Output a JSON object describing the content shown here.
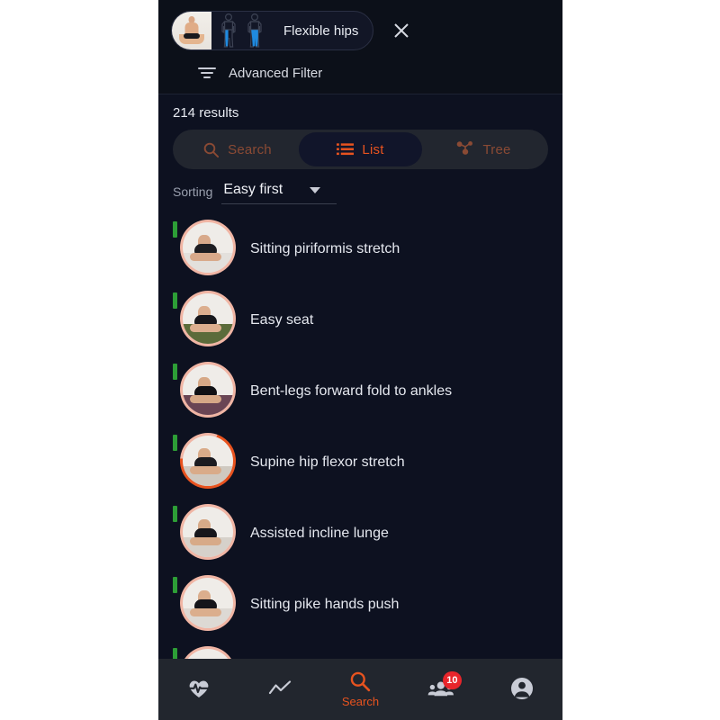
{
  "theme": {
    "page_bg": "#ffffff",
    "app_bg": "#0d1120",
    "topbar_bg": "#0c1019",
    "accent": "#e8531f",
    "accent_muted": "#8a4a34",
    "badge_red": "#e8252b",
    "difficulty_green": "#2d9e36",
    "ring_pink": "#f0b5a4",
    "nav_bg": "#22262e"
  },
  "filter": {
    "chip": {
      "label": "Flexible hips",
      "photo_icon": "seated-lotus-photo",
      "body_diagram_icon": "body-front-back-diagram",
      "highlight_color": "#1f8ae0"
    },
    "close_icon": "close-icon",
    "advanced_filter": {
      "label": "Advanced Filter",
      "icon": "tune-filter-icon"
    }
  },
  "results": {
    "count_label": "214 results",
    "tabs": [
      {
        "label": "Search",
        "icon": "search-icon",
        "active": false
      },
      {
        "label": "List",
        "icon": "list-icon",
        "active": true
      },
      {
        "label": "Tree",
        "icon": "tree-node-icon",
        "active": false
      }
    ],
    "sorting": {
      "label": "Sorting",
      "value": "Easy first",
      "caret_icon": "chevron-down-icon"
    },
    "items": [
      {
        "title": "Sitting piriformis stretch",
        "difficulty": "easy",
        "ring": "pink",
        "thumb": {
          "floor": "#e3e0dc",
          "skin": "#d8a98a",
          "outfit": "#1d1d22",
          "mat": "#d9d6d2"
        }
      },
      {
        "title": "Easy seat",
        "difficulty": "easy",
        "ring": "pink",
        "thumb": {
          "floor": "#5b6b3a",
          "skin": "#dcae8e",
          "outfit": "#17171c",
          "mat": "#6d7d46"
        }
      },
      {
        "title": "Bent-legs forward fold to ankles",
        "difficulty": "easy",
        "ring": "pink",
        "thumb": {
          "floor": "#6a4554",
          "skin": "#d6a886",
          "outfit": "#101014",
          "mat": "#7a5161"
        }
      },
      {
        "title": "Supine hip flexor stretch",
        "difficulty": "easy",
        "ring": "progress",
        "thumb": {
          "floor": "#cfc9c0",
          "skin": "#d9ab89",
          "outfit": "#1b1b20",
          "mat": "#c8a濃"
        }
      },
      {
        "title": "Assisted incline lunge",
        "difficulty": "easy",
        "ring": "pink",
        "thumb": {
          "floor": "#d6d1ca",
          "skin": "#d7aa88",
          "outfit": "#16161b",
          "mat": "#c9a878"
        }
      },
      {
        "title": "Sitting pike hands push",
        "difficulty": "easy",
        "ring": "pink",
        "thumb": {
          "floor": "#ddd9d4",
          "skin": "#dbae8d",
          "outfit": "#15151a",
          "mat": "#8e6f78"
        }
      },
      {
        "title": "",
        "difficulty": "easy",
        "ring": "pink",
        "thumb": {
          "floor": "#e0dcd7",
          "skin": "#d9ab89",
          "outfit": "#17171c",
          "mat": "#d2cec8"
        }
      }
    ]
  },
  "bottom_nav": [
    {
      "icon": "heart-pulse-icon",
      "label": "",
      "active": false,
      "badge": ""
    },
    {
      "icon": "trending-line-icon",
      "label": "",
      "active": false,
      "badge": ""
    },
    {
      "icon": "search-icon",
      "label": "Search",
      "active": true,
      "badge": ""
    },
    {
      "icon": "people-group-icon",
      "label": "",
      "active": false,
      "badge": "10"
    },
    {
      "icon": "account-circle-icon",
      "label": "",
      "active": false,
      "badge": ""
    }
  ]
}
